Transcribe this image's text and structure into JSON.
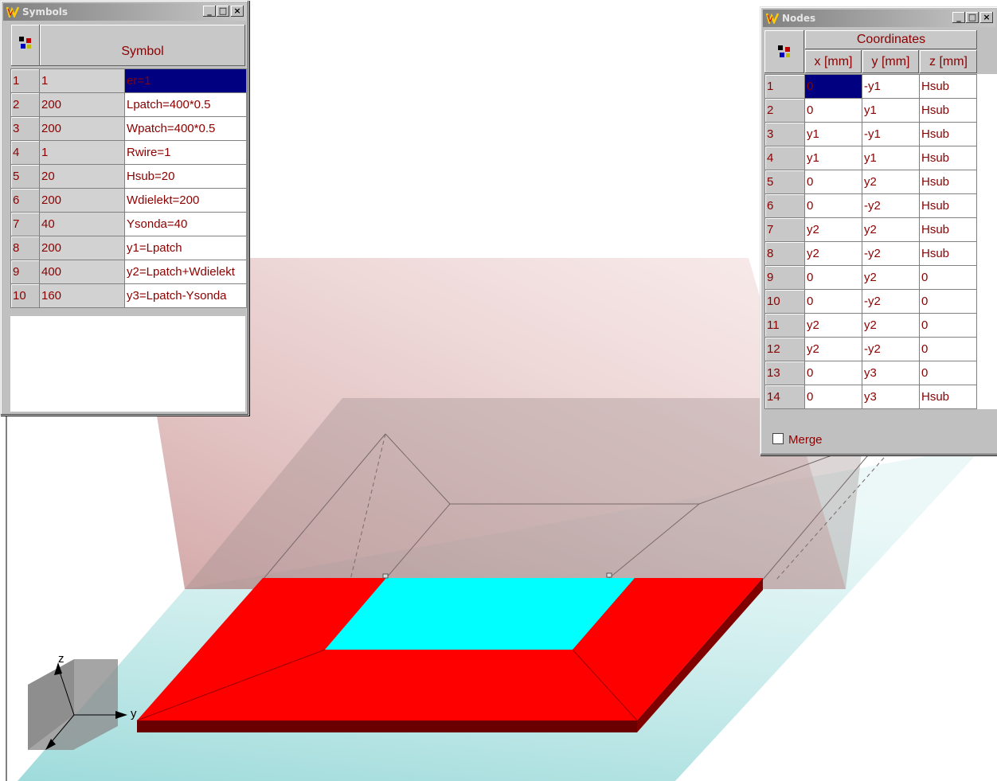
{
  "symbols_window": {
    "title": "Symbols",
    "header": "Symbol",
    "rows": [
      {
        "n": "1",
        "value": "1",
        "expr": "er=1"
      },
      {
        "n": "2",
        "value": "200",
        "expr": "Lpatch=400*0.5"
      },
      {
        "n": "3",
        "value": "200",
        "expr": "Wpatch=400*0.5"
      },
      {
        "n": "4",
        "value": "1",
        "expr": "Rwire=1"
      },
      {
        "n": "5",
        "value": "20",
        "expr": "Hsub=20"
      },
      {
        "n": "6",
        "value": "200",
        "expr": "Wdielekt=200"
      },
      {
        "n": "7",
        "value": "40",
        "expr": "Ysonda=40"
      },
      {
        "n": "8",
        "value": "200",
        "expr": "y1=Lpatch"
      },
      {
        "n": "9",
        "value": "400",
        "expr": "y2=Lpatch+Wdielekt"
      },
      {
        "n": "10",
        "value": "160",
        "expr": "y3=Lpatch-Ysonda"
      }
    ]
  },
  "nodes_window": {
    "title": "Nodes",
    "group_header": "Coordinates",
    "columns": [
      "x [mm]",
      "y [mm]",
      "z [mm]"
    ],
    "rows": [
      {
        "n": "1",
        "x": "0",
        "y": "-y1",
        "z": "Hsub"
      },
      {
        "n": "2",
        "x": "0",
        "y": "y1",
        "z": "Hsub"
      },
      {
        "n": "3",
        "x": "y1",
        "y": "-y1",
        "z": "Hsub"
      },
      {
        "n": "4",
        "x": "y1",
        "y": "y1",
        "z": "Hsub"
      },
      {
        "n": "5",
        "x": "0",
        "y": "y2",
        "z": "Hsub"
      },
      {
        "n": "6",
        "x": "0",
        "y": "-y2",
        "z": "Hsub"
      },
      {
        "n": "7",
        "x": "y2",
        "y": "y2",
        "z": "Hsub"
      },
      {
        "n": "8",
        "x": "y2",
        "y": "-y2",
        "z": "Hsub"
      },
      {
        "n": "9",
        "x": "0",
        "y": "y2",
        "z": "0"
      },
      {
        "n": "10",
        "x": "0",
        "y": "-y2",
        "z": "0"
      },
      {
        "n": "11",
        "x": "y2",
        "y": "y2",
        "z": "0"
      },
      {
        "n": "12",
        "x": "y2",
        "y": "-y2",
        "z": "0"
      },
      {
        "n": "13",
        "x": "0",
        "y": "y3",
        "z": "0"
      },
      {
        "n": "14",
        "x": "0",
        "y": "y3",
        "z": "Hsub"
      }
    ],
    "merge_label": "Merge"
  },
  "axes": {
    "z": "z",
    "y": "y"
  },
  "window_buttons": {
    "minimize": "_",
    "maximize": "□",
    "close": "×"
  },
  "colors": {
    "patch": "#ff0000",
    "patch_edge": "#6b0000",
    "aperture": "#00ffff",
    "ground_plane": "#a8dcdc",
    "back_plane": "#d9a8a8",
    "cell_text": "#8b0000"
  }
}
